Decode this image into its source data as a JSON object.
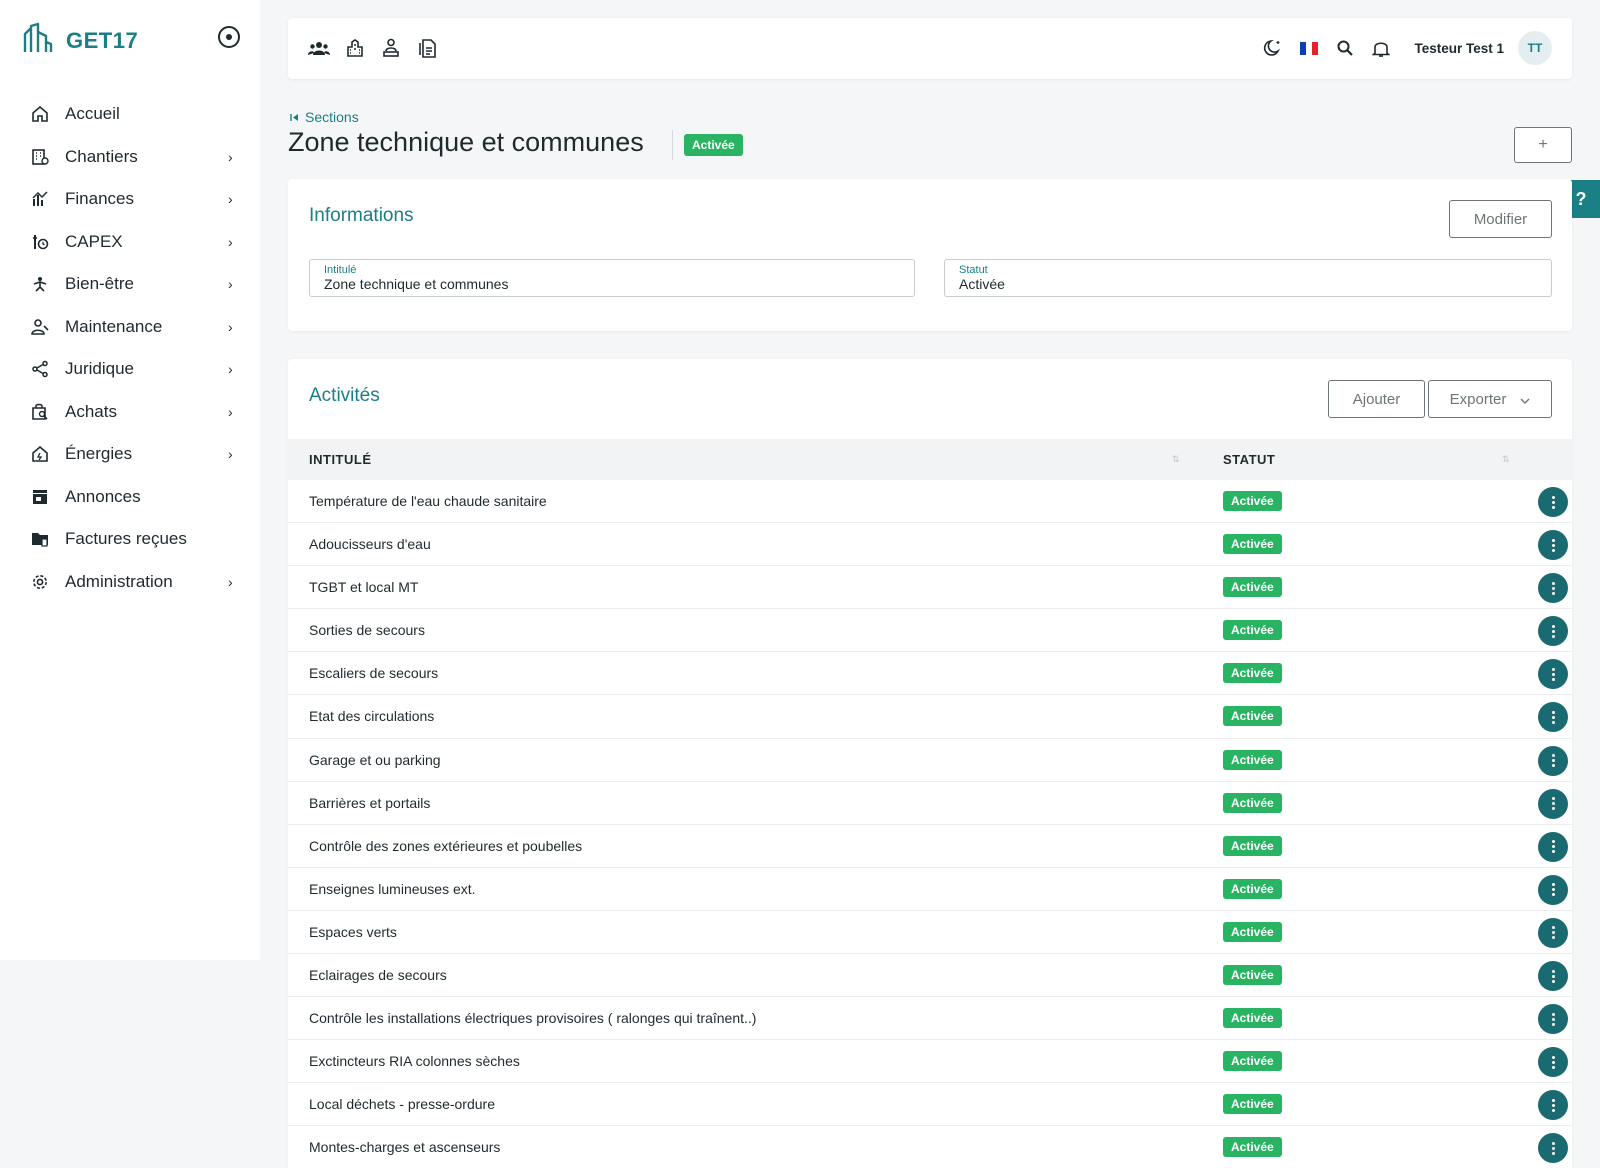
{
  "app": {
    "brand": "GET17"
  },
  "sidebar": {
    "items": [
      {
        "label": "Accueil",
        "icon": "home-icon",
        "chevron": false
      },
      {
        "label": "Chantiers",
        "icon": "building-icon",
        "chevron": true
      },
      {
        "label": "Finances",
        "icon": "chart-icon",
        "chevron": true
      },
      {
        "label": "CAPEX",
        "icon": "capex-icon",
        "chevron": true
      },
      {
        "label": "Bien-être",
        "icon": "wellbeing-icon",
        "chevron": true
      },
      {
        "label": "Maintenance",
        "icon": "maintenance-icon",
        "chevron": true
      },
      {
        "label": "Juridique",
        "icon": "share-icon",
        "chevron": true
      },
      {
        "label": "Achats",
        "icon": "shopping-icon",
        "chevron": true
      },
      {
        "label": "Énergies",
        "icon": "energy-icon",
        "chevron": true
      },
      {
        "label": "Annonces",
        "icon": "store-icon",
        "chevron": false
      },
      {
        "label": "Factures reçues",
        "icon": "folder-icon",
        "chevron": false
      },
      {
        "label": "Administration",
        "icon": "gear-icon",
        "chevron": true
      }
    ]
  },
  "topbar": {
    "user_name": "Testeur Test 1",
    "avatar_initials": "TT"
  },
  "header": {
    "breadcrumb": "Sections",
    "title": "Zone technique et communes",
    "status": "Activée",
    "add_label": "+"
  },
  "help": {
    "label": "?"
  },
  "info": {
    "title": "Informations",
    "edit_label": "Modifier",
    "fields": [
      {
        "label": "Intitulé",
        "value": "Zone technique et communes"
      },
      {
        "label": "Statut",
        "value": "Activée"
      }
    ]
  },
  "activities": {
    "title": "Activités",
    "add_label": "Ajouter",
    "export_label": "Exporter",
    "columns": [
      "INTITULÉ",
      "STATUT"
    ],
    "rows": [
      {
        "name": "Température de l'eau chaude sanitaire",
        "status": "Activée"
      },
      {
        "name": "Adoucisseurs d'eau",
        "status": "Activée"
      },
      {
        "name": "TGBT et local MT",
        "status": "Activée"
      },
      {
        "name": "Sorties de secours",
        "status": "Activée"
      },
      {
        "name": "Escaliers de secours",
        "status": "Activée"
      },
      {
        "name": "Etat des circulations",
        "status": "Activée"
      },
      {
        "name": "Garage et ou parking",
        "status": "Activée"
      },
      {
        "name": "Barrières et portails",
        "status": "Activée"
      },
      {
        "name": "Contrôle des zones extérieures et poubelles",
        "status": "Activée"
      },
      {
        "name": "Enseignes lumineuses ext.",
        "status": "Activée"
      },
      {
        "name": "Espaces verts",
        "status": "Activée"
      },
      {
        "name": "Eclairages de secours",
        "status": "Activée"
      },
      {
        "name": "Contrôle les installations électriques provisoires ( ralonges qui traînent..)",
        "status": "Activée"
      },
      {
        "name": "Exctincteurs RIA colonnes sèches",
        "status": "Activée"
      },
      {
        "name": "Local déchets - presse-ordure",
        "status": "Activée"
      },
      {
        "name": "Montes-charges et ascenseurs",
        "status": "Activée"
      }
    ]
  },
  "colors": {
    "accent": "#1b7f86",
    "success": "#28b463",
    "kebab": "#1a6b71"
  }
}
